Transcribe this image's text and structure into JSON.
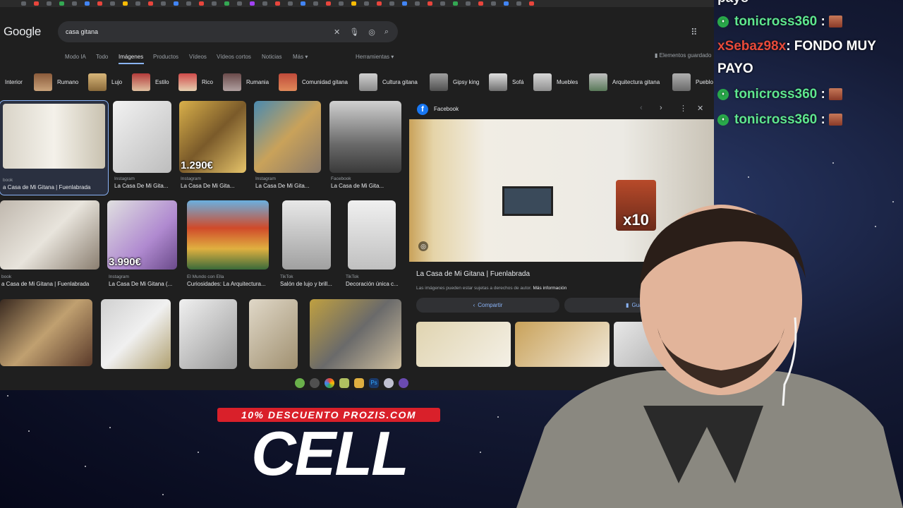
{
  "google": {
    "logo": "Google",
    "query": "casa gitana",
    "tabs": [
      "Modo IA",
      "Todo",
      "Imágenes",
      "Productos",
      "Vídeos",
      "Vídeos cortos",
      "Noticias",
      "Más ▾",
      "Herramientas ▾"
    ],
    "saved_label": "Elementos guardado",
    "chips": [
      "Interior",
      "Rumano",
      "Lujo",
      "Estilo",
      "Rico",
      "Rumania",
      "Comunidad gitana",
      "Cultura gitana",
      "Gipsy king",
      "Sofá",
      "Muebles",
      "Arquitectura gitana",
      "Pueblo"
    ]
  },
  "results": [
    {
      "source": "book",
      "caption": "a Casa de Mi Gitana | Fuenlabrada",
      "price": ""
    },
    {
      "source": "Instagram",
      "caption": "La Casa De Mi Gita...",
      "price": ""
    },
    {
      "source": "Instagram",
      "caption": "La Casa De Mi Gita...",
      "price": "1.290€"
    },
    {
      "source": "Instagram",
      "caption": "La Casa De Mi Gita...",
      "price": ""
    },
    {
      "source": "Facebook",
      "caption": "La Casa de Mi Gita...",
      "price": ""
    },
    {
      "source": "book",
      "caption": "a Casa de Mi Gitana | Fuenlabrada",
      "price": ""
    },
    {
      "source": "Instagram",
      "caption": "La Casa De Mi Gitana (...",
      "price": "3.990€"
    },
    {
      "source": "El Mundo con Ella",
      "caption": "Curiosidades: La Arquitectura...",
      "price": ""
    },
    {
      "source": "TikTok",
      "caption": "Salón de lujo y brill...",
      "price": ""
    },
    {
      "source": "TikTok",
      "caption": "Decoración única c...",
      "price": ""
    }
  ],
  "preview": {
    "source": "Facebook",
    "title": "La Casa de Mi Gitana | Fuenlabrada",
    "copyright": "Las imágenes pueden estar sujetas a derechos de autor.",
    "more_info": "Más información",
    "share_label": "Compartir",
    "save_label": "Guardar",
    "overlay_text": "x10"
  },
  "chat": [
    {
      "user": "payo",
      "text": "",
      "color": "#e8eaed"
    },
    {
      "user": "tonicross360",
      "text": " :",
      "color": "#5ee68f"
    },
    {
      "user": "xSebaz98x",
      "text": ": FONDO MUY",
      "color": "#e84a3a"
    },
    {
      "user": "",
      "text": "PAYO",
      "color": "#ffffff"
    },
    {
      "user": "tonicross360",
      "text": " :",
      "color": "#5ee68f"
    },
    {
      "user": "tonicross360",
      "text": " :",
      "color": "#5ee68f"
    }
  ],
  "overlay": {
    "promo": "10% DESCUENTO PROZIS.COM",
    "brand": "CELL"
  }
}
